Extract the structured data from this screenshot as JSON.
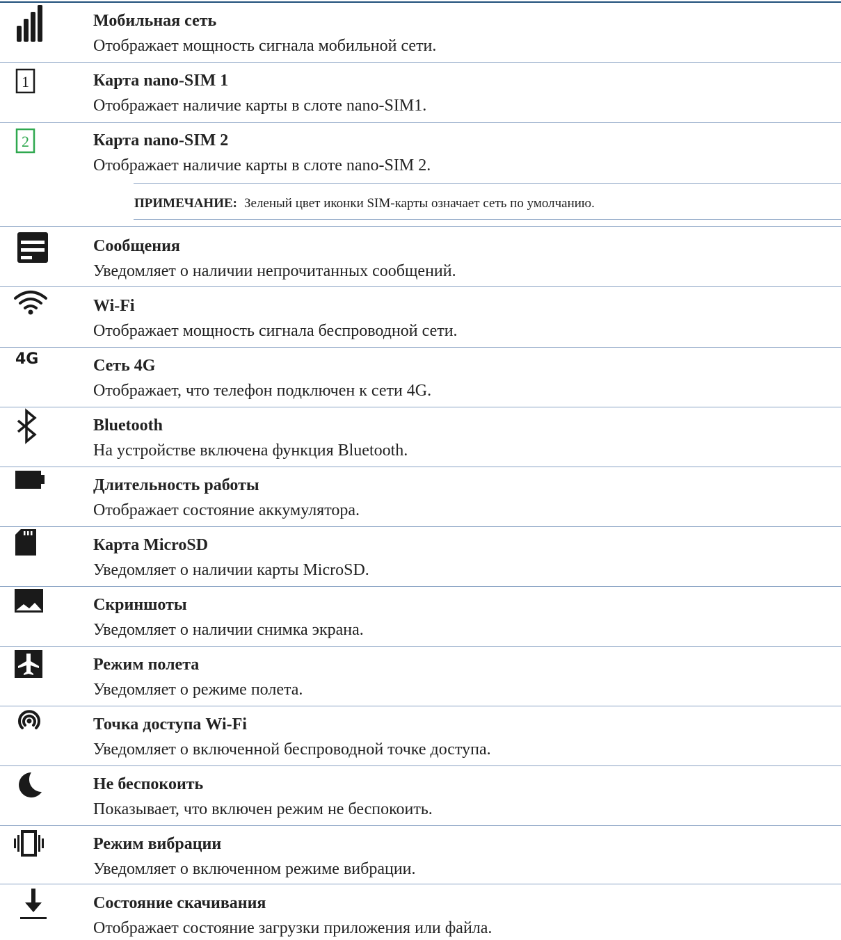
{
  "items": [
    {
      "icon": "signal-bars-icon",
      "title": "Мобильная сеть",
      "desc": "Отображает мощность сигнала мобильной сети."
    },
    {
      "icon": "sim-card-1-icon",
      "icon_text": "1",
      "title": "Карта nano-SIM 1",
      "desc": "Отображает наличие карты в слоте nano-SIM1."
    },
    {
      "icon": "sim-card-2-icon",
      "icon_text": "2",
      "title": "Карта nano-SIM 2",
      "desc": "Отображает наличие карты в слоте nano-SIM 2."
    },
    {
      "icon": "message-icon",
      "title": "Сообщения",
      "desc": "Уведомляет о наличии непрочитанных сообщений."
    },
    {
      "icon": "wifi-icon",
      "title": "Wi-Fi",
      "desc": "Отображает мощность сигнала беспроводной сети."
    },
    {
      "icon": "4g-icon",
      "icon_text": "4G",
      "title": "Сеть 4G",
      "desc": "Отображает, что телефон подключен к сети 4G."
    },
    {
      "icon": "bluetooth-icon",
      "title": "Bluetooth",
      "desc": "На устройстве включена функция Bluetooth."
    },
    {
      "icon": "battery-icon",
      "title": "Длительность работы",
      "desc": "Отображает состояние аккумулятора."
    },
    {
      "icon": "microsd-card-icon",
      "title": "Карта MicroSD",
      "desc": "Уведомляет о наличии карты MicroSD."
    },
    {
      "icon": "screenshot-image-icon",
      "title": "Скриншоты",
      "desc": "Уведомляет о наличии снимка экрана."
    },
    {
      "icon": "airplane-icon",
      "title": "Режим полета",
      "desc": "Уведомляет о режиме полета."
    },
    {
      "icon": "hotspot-icon",
      "title": "Точка доступа Wi-Fi",
      "desc": "Уведомляет о включенной беспроводной точке доступа."
    },
    {
      "icon": "moon-icon",
      "title": "Не беспокоить",
      "desc": "Показывает, что включен режим не беспокоить."
    },
    {
      "icon": "vibrate-icon",
      "title": "Режим вибрации",
      "desc": "Уведомляет о включенном режиме вибрации."
    },
    {
      "icon": "download-icon",
      "title": "Состояние скачивания",
      "desc": "Отображает состояние загрузки приложения или файла."
    }
  ],
  "note": {
    "label": "ПРИМЕЧАНИЕ:",
    "text": "Зеленый цвет иконки SIM-карты означает сеть по умолчанию."
  },
  "colors": {
    "rule": "#1f4f7a",
    "separator": "#8aa3c4",
    "icon": "#1a1a1a",
    "default_sim": "#2fa84f"
  }
}
